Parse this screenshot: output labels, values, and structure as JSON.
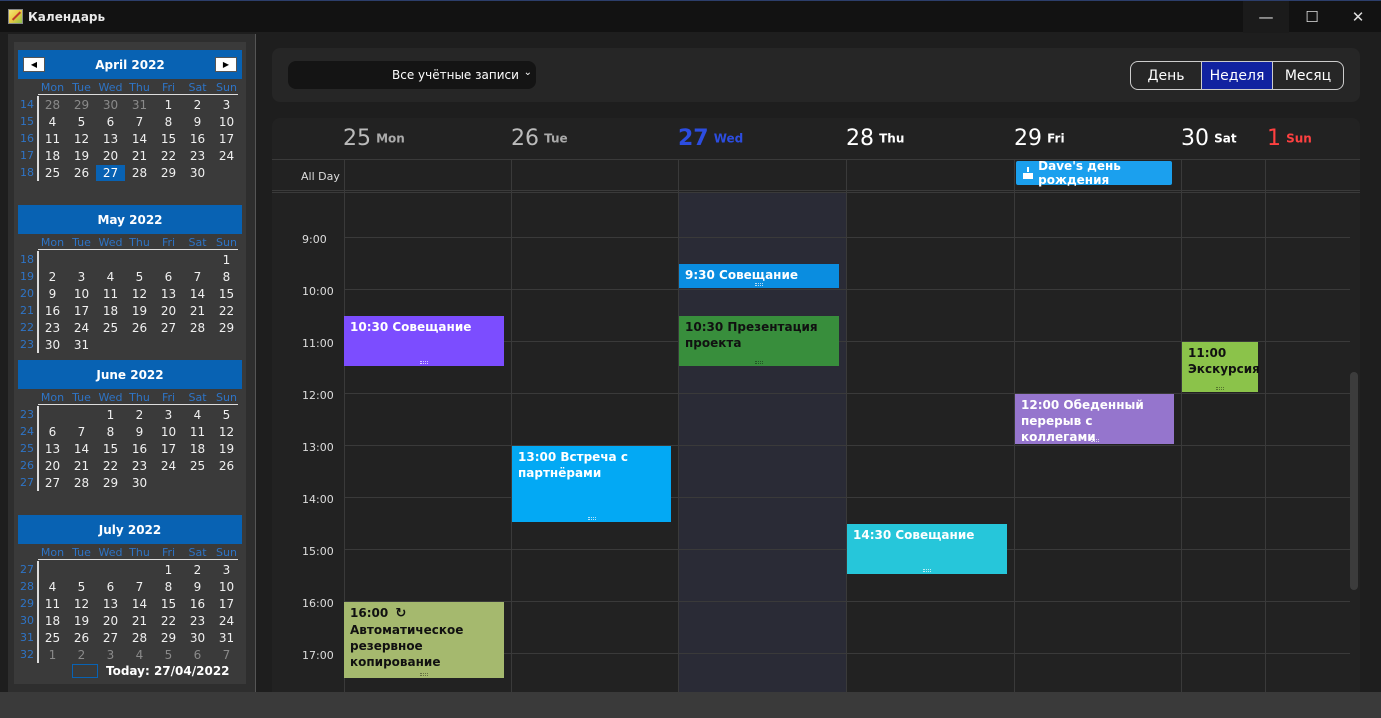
{
  "window": {
    "title": "Календарь"
  },
  "toolbar": {
    "account_select": "Все учётные записи",
    "views": {
      "day": "День",
      "week": "Неделя",
      "month": "Месяц"
    }
  },
  "mini_calendars": [
    {
      "title": "April 2022",
      "days_of_week": [
        "Mon",
        "Tue",
        "Wed",
        "Thu",
        "Fri",
        "Sat",
        "Sun"
      ],
      "weeks": [
        {
          "wk": "14",
          "days": [
            "28",
            "29",
            "30",
            "31",
            "1",
            "2",
            "3"
          ],
          "dim": [
            0,
            1,
            2,
            3
          ]
        },
        {
          "wk": "15",
          "days": [
            "4",
            "5",
            "6",
            "7",
            "8",
            "9",
            "10"
          ],
          "dim": []
        },
        {
          "wk": "16",
          "days": [
            "11",
            "12",
            "13",
            "14",
            "15",
            "16",
            "17"
          ],
          "dim": []
        },
        {
          "wk": "17",
          "days": [
            "18",
            "19",
            "20",
            "21",
            "22",
            "23",
            "24"
          ],
          "dim": []
        },
        {
          "wk": "18",
          "days": [
            "25",
            "26",
            "27",
            "28",
            "29",
            "30",
            ""
          ],
          "dim": [],
          "sel": 2
        }
      ]
    },
    {
      "title": "May 2022",
      "days_of_week": [
        "Mon",
        "Tue",
        "Wed",
        "Thu",
        "Fri",
        "Sat",
        "Sun"
      ],
      "weeks": [
        {
          "wk": "18",
          "days": [
            "",
            "",
            "",
            "",
            "",
            "",
            "1"
          ],
          "dim": []
        },
        {
          "wk": "19",
          "days": [
            "2",
            "3",
            "4",
            "5",
            "6",
            "7",
            "8"
          ],
          "dim": []
        },
        {
          "wk": "20",
          "days": [
            "9",
            "10",
            "11",
            "12",
            "13",
            "14",
            "15"
          ],
          "dim": []
        },
        {
          "wk": "21",
          "days": [
            "16",
            "17",
            "18",
            "19",
            "20",
            "21",
            "22"
          ],
          "dim": []
        },
        {
          "wk": "22",
          "days": [
            "23",
            "24",
            "25",
            "26",
            "27",
            "28",
            "29"
          ],
          "dim": []
        },
        {
          "wk": "23",
          "days": [
            "30",
            "31",
            "",
            "",
            "",
            "",
            ""
          ],
          "dim": []
        }
      ]
    },
    {
      "title": "June 2022",
      "days_of_week": [
        "Mon",
        "Tue",
        "Wed",
        "Thu",
        "Fri",
        "Sat",
        "Sun"
      ],
      "weeks": [
        {
          "wk": "23",
          "days": [
            "",
            "",
            "1",
            "2",
            "3",
            "4",
            "5"
          ],
          "dim": []
        },
        {
          "wk": "24",
          "days": [
            "6",
            "7",
            "8",
            "9",
            "10",
            "11",
            "12"
          ],
          "dim": []
        },
        {
          "wk": "25",
          "days": [
            "13",
            "14",
            "15",
            "16",
            "17",
            "18",
            "19"
          ],
          "dim": []
        },
        {
          "wk": "26",
          "days": [
            "20",
            "21",
            "22",
            "23",
            "24",
            "25",
            "26"
          ],
          "dim": []
        },
        {
          "wk": "27",
          "days": [
            "27",
            "28",
            "29",
            "30",
            "",
            "",
            ""
          ],
          "dim": []
        }
      ]
    },
    {
      "title": "July 2022",
      "days_of_week": [
        "Mon",
        "Tue",
        "Wed",
        "Thu",
        "Fri",
        "Sat",
        "Sun"
      ],
      "weeks": [
        {
          "wk": "27",
          "days": [
            "",
            "",
            "",
            "",
            "1",
            "2",
            "3"
          ],
          "dim": []
        },
        {
          "wk": "28",
          "days": [
            "4",
            "5",
            "6",
            "7",
            "8",
            "9",
            "10"
          ],
          "dim": []
        },
        {
          "wk": "29",
          "days": [
            "11",
            "12",
            "13",
            "14",
            "15",
            "16",
            "17"
          ],
          "dim": []
        },
        {
          "wk": "30",
          "days": [
            "18",
            "19",
            "20",
            "21",
            "22",
            "23",
            "24"
          ],
          "dim": []
        },
        {
          "wk": "31",
          "days": [
            "25",
            "26",
            "27",
            "28",
            "29",
            "30",
            "31"
          ],
          "dim": []
        },
        {
          "wk": "32",
          "days": [
            "1",
            "2",
            "3",
            "4",
            "5",
            "6",
            "7"
          ],
          "dim": [
            0,
            1,
            2,
            3,
            4,
            5,
            6
          ]
        }
      ]
    }
  ],
  "today_label": "Today: 27/04/2022",
  "week_header": [
    {
      "num": "25",
      "name": "Mon"
    },
    {
      "num": "26",
      "name": "Tue"
    },
    {
      "num": "27",
      "name": "Wed"
    },
    {
      "num": "28",
      "name": "Thu"
    },
    {
      "num": "29",
      "name": "Fri"
    },
    {
      "num": "30",
      "name": "Sat"
    },
    {
      "num": "1",
      "name": "Sun"
    }
  ],
  "allday_label": "All Day",
  "hours": [
    "9:00",
    "10:00",
    "11:00",
    "12:00",
    "13:00",
    "14:00",
    "15:00",
    "16:00",
    "17:00"
  ],
  "allday_event": "Dave's день рождения",
  "events": {
    "e1": "10:30 Совещание",
    "e2": "9:30 Совещание",
    "e3": "10:30 Презентация проекта",
    "e4": "11:00 Экскурсия",
    "e5": "12:00 Обеденный перерыв с коллегами",
    "e6": "13:00 Встреча с партнёрами",
    "e7": "14:30 Совещание",
    "e8_time": "16:00",
    "e8_text": "Автоматическое резервное копирование"
  },
  "colors": {
    "accent": "#0862b3",
    "today": "#2c4de0",
    "sunday": "#ff4040",
    "purple": "#7c4dff",
    "blue": "#0a8de0",
    "green": "#388e3c",
    "lime": "#8bc34a",
    "lavender": "#9575cd",
    "sky": "#03a9f4",
    "cyan": "#26c6da",
    "olive": "#a5b96e"
  }
}
